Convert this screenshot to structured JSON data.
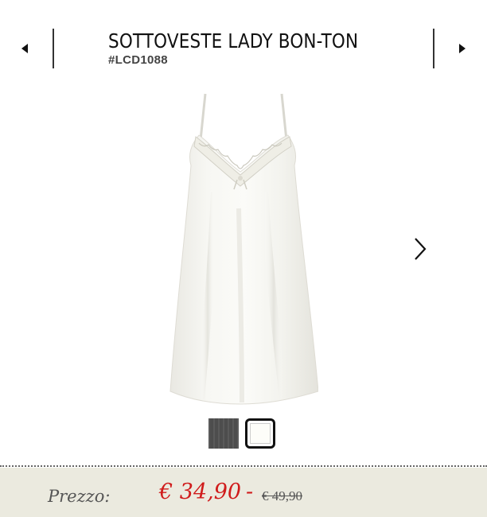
{
  "header": {
    "title": "SOTTOVESTE LADY BON-TON",
    "sku": "#LCD1088",
    "prev_icon": "triangle-left-icon",
    "next_icon": "triangle-right-icon"
  },
  "gallery": {
    "image_subject": "ivory satin slip dress with lace neckline",
    "next_icon": "chevron-right-icon",
    "swatches": [
      {
        "color": "#4d4d4d",
        "selected": false
      },
      {
        "color": "#fdfdf9",
        "selected": true
      }
    ]
  },
  "price": {
    "label": "Prezzo:",
    "current": "€ 34,90",
    "separator": "-",
    "original": "€ 49,90",
    "current_color": "#d01c1c"
  }
}
